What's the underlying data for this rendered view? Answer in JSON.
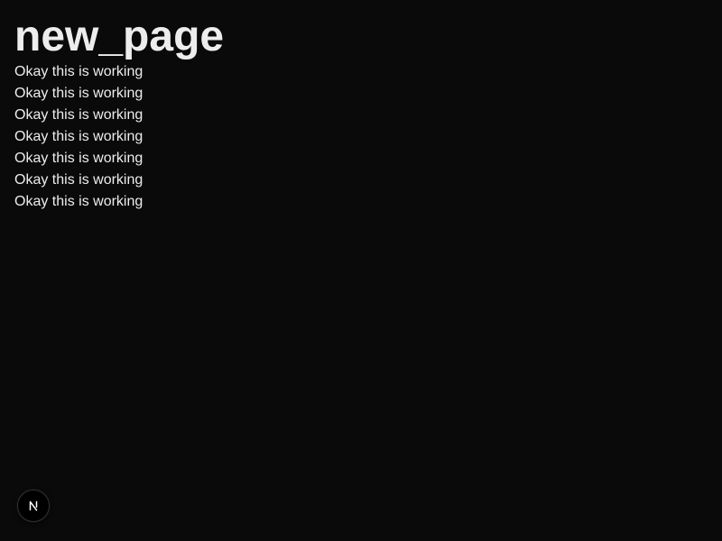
{
  "page": {
    "title": "new_page",
    "lines": [
      "Okay this is working",
      "Okay this is working",
      "Okay this is working",
      "Okay this is working",
      "Okay this is working",
      "Okay this is working",
      "Okay this is working"
    ]
  },
  "dev_badge": {
    "icon": "nextjs-logo-icon"
  },
  "colors": {
    "background": "#0a0a0a",
    "text": "#ededed",
    "badge_background": "#000000"
  }
}
